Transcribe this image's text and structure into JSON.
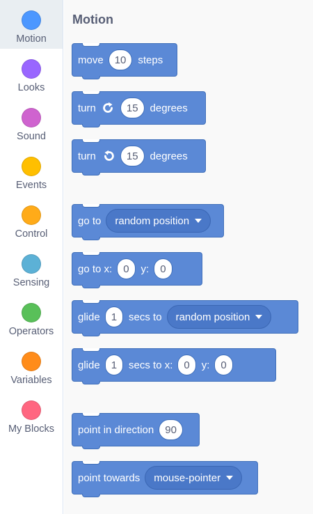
{
  "categories": [
    {
      "label": "Motion",
      "color": "#4c97ff"
    },
    {
      "label": "Looks",
      "color": "#9966ff"
    },
    {
      "label": "Sound",
      "color": "#cf63cf"
    },
    {
      "label": "Events",
      "color": "#ffbf00"
    },
    {
      "label": "Control",
      "color": "#ffab19"
    },
    {
      "label": "Sensing",
      "color": "#5cb1d6"
    },
    {
      "label": "Operators",
      "color": "#59c059"
    },
    {
      "label": "Variables",
      "color": "#ff8c1a"
    },
    {
      "label": "My Blocks",
      "color": "#ff6680"
    }
  ],
  "palette": {
    "heading": "Motion",
    "move": {
      "pre": "move",
      "value": "10",
      "post": "steps"
    },
    "turn_right": {
      "pre": "turn",
      "icon": "rotate-right-icon",
      "value": "15",
      "post": "degrees"
    },
    "turn_left": {
      "pre": "turn",
      "icon": "rotate-left-icon",
      "value": "15",
      "post": "degrees"
    },
    "go_to": {
      "pre": "go to",
      "dropdown": "random position"
    },
    "go_to_xy": {
      "pre": "go to x:",
      "x": "0",
      "mid": "y:",
      "y": "0"
    },
    "glide_to": {
      "pre": "glide",
      "value": "1",
      "mid": "secs to",
      "dropdown": "random position"
    },
    "glide_xy": {
      "pre": "glide",
      "value": "1",
      "mid": "secs to x:",
      "x": "0",
      "mid2": "y:",
      "y": "0"
    },
    "point_direction": {
      "pre": "point in direction",
      "value": "90"
    },
    "point_towards": {
      "pre": "point towards",
      "dropdown": "mouse-pointer"
    }
  }
}
